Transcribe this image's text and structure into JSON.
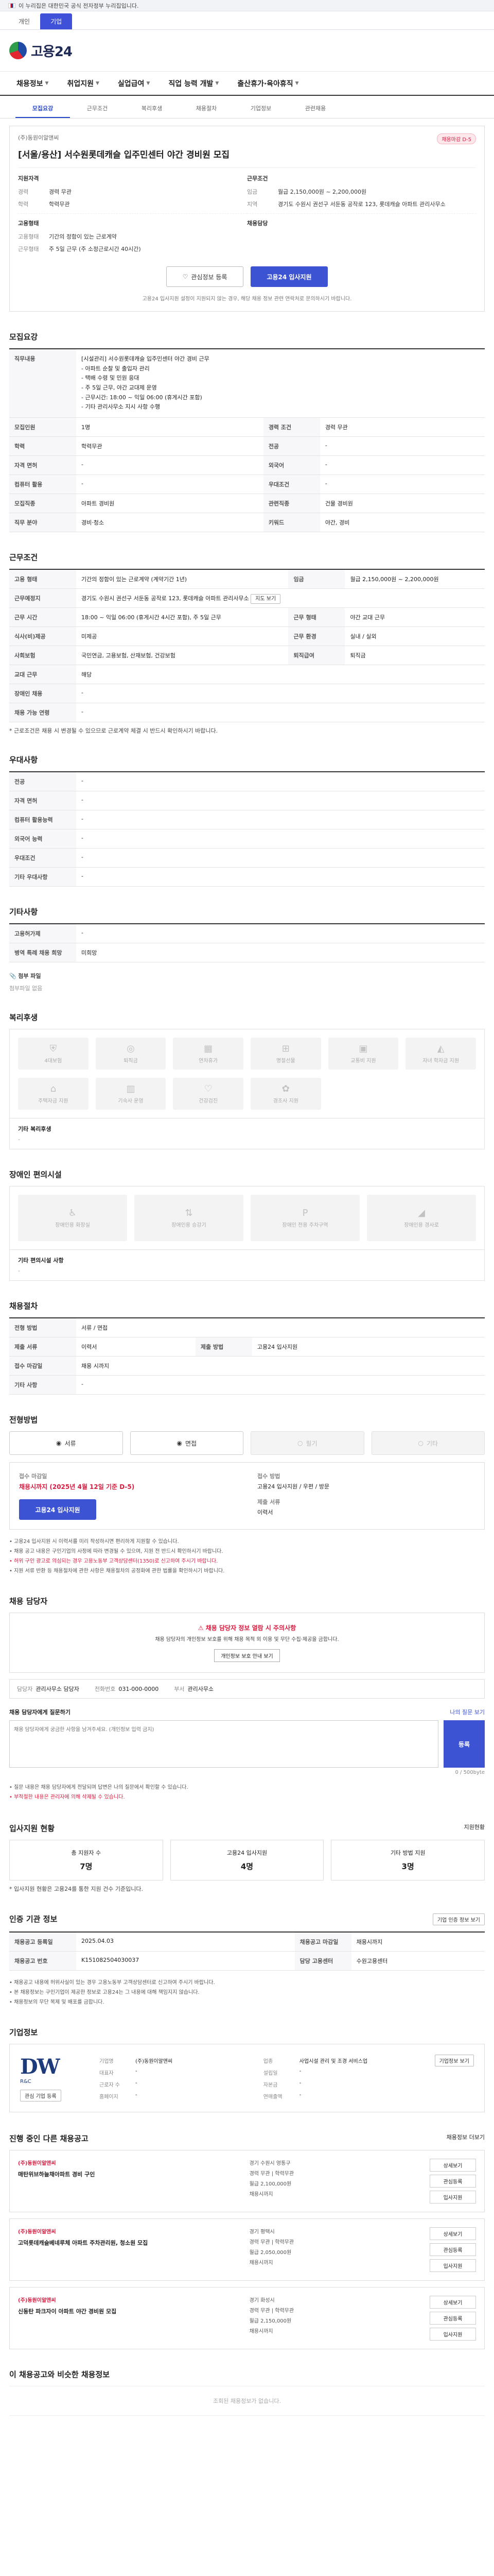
{
  "gov_banner": "이 누리집은 대한민국 공식 전자정부 누리집입니다.",
  "site_tabs": [
    "개인",
    "기업"
  ],
  "logo": "고용24",
  "gnb": [
    "채용정보",
    "취업지원",
    "실업급여",
    "직업 능력 개발",
    "출산휴가·육아휴직"
  ],
  "detail_tabs": [
    "모집요강",
    "근무조건",
    "복리후생",
    "채용절차",
    "기업정보",
    "관련채용"
  ],
  "summary": {
    "company": "(주)동원이알앤씨",
    "badge": "채용마감 D-5",
    "title": "[서울/용산] 서수원롯데캐슬 입주민센터 야간 경비원 모집",
    "left_head": "지원자격",
    "left": [
      {
        "k": "경력",
        "v": "경력 무관"
      },
      {
        "k": "학력",
        "v": "학력무관"
      }
    ],
    "right_head": "근무조건",
    "right": [
      {
        "k": "임금",
        "v": "월급 2,150,000원 ~ 2,200,000원"
      },
      {
        "k": "지역",
        "v": "경기도 수원시 권선구 서둔동 공작로 123, 롯데캐슬 아파트 관리사무소"
      }
    ],
    "left2_head": "고용형태",
    "left2": [
      {
        "k": "고용형태",
        "v": "기간의 정함이 있는 근로계약"
      },
      {
        "k": "근무형태",
        "v": "주 5일 근무 (주 소정근로시간 40시간)"
      }
    ],
    "right2_head": "채용담당",
    "right2": [
      {
        "k": "",
        "v": ""
      }
    ],
    "btn_scrap": "관심정보 등록",
    "btn_apply": "고용24 입사지원",
    "note": "고용24 입사지원 설정이 지원되지 않는 경우, 해당 채용 정보 관련 연락처로 문의하시기 바랍니다."
  },
  "recruit": {
    "title": "모집요강",
    "rows": [
      {
        "k": "직무내용",
        "v": "[시설관리] 서수원롯데캐슬 입주민센터 야간 경비 근무\n- 아파트 순찰 및 출입자 관리\n- 택배 수령 및 민원 응대\n- 주 5일 근무, 야간 교대제 운영\n- 근무시간: 18:00 ~ 익일 06:00 (휴게시간 포함)\n- 기타 관리사무소 지시 사항 수행"
      },
      {
        "k": "모집인원",
        "v": "1명",
        "k2": "경력 조건",
        "v2": "경력 무관"
      },
      {
        "k": "학력",
        "v": "학력무관",
        "k2": "전공",
        "v2": "-"
      },
      {
        "k": "자격 면허",
        "v": "-",
        "k2": "외국어",
        "v2": "-"
      },
      {
        "k": "컴퓨터 활용",
        "v": "-",
        "k2": "우대조건",
        "v2": "-"
      },
      {
        "k": "모집직종",
        "v": "아파트 경비원",
        "k2": "관련직종",
        "v2": "건물 경비원"
      },
      {
        "k": "직무 분야",
        "v": "경비·청소",
        "k2": "키워드",
        "v2": "야간, 경비"
      }
    ]
  },
  "conditions": {
    "title": "근무조건",
    "rows": [
      {
        "k": "고용 형태",
        "v": "기간의 정함이 있는 근로계약 (계약기간 1년)",
        "k2": "임금",
        "v2": "월급 2,150,000원 ~ 2,200,000원"
      },
      {
        "k": "근무예정지",
        "v": "경기도 수원시 권선구 서둔동 공작로 123, 롯데캐슬 아파트 관리사무소",
        "k2": "",
        "v2": ""
      },
      {
        "k": "근무 시간",
        "v": "18:00 ~ 익일 06:00 (휴게시간 4시간 포함), 주 5일 근무",
        "k2": "근무 형태",
        "v2": "야간 교대 근무"
      },
      {
        "k": "식사(비)제공",
        "v": "미제공",
        "k2": "근무 환경",
        "v2": "실내 / 실외"
      },
      {
        "k": "사회보험",
        "v": "국민연금, 고용보험, 산재보험, 건강보험",
        "k2": "퇴직급여",
        "v2": "퇴직금"
      },
      {
        "k": "교대 근무",
        "v": "해당",
        "k2": "",
        "v2": ""
      },
      {
        "k": "장애인 채용",
        "v": "-",
        "k2": "",
        "v2": ""
      },
      {
        "k": "채용 가능 연령",
        "v": "-",
        "k2": "",
        "v2": ""
      }
    ],
    "map_btn": "지도 보기",
    "note": "* 근로조건은 채용 시 변경될 수 있으므로 근로계약 체결 시 반드시 확인하시기 바랍니다."
  },
  "prefs": {
    "title": "우대사항",
    "rows": [
      {
        "k": "전공",
        "v": "-"
      },
      {
        "k": "자격 면허",
        "v": "-"
      },
      {
        "k": "컴퓨터 활용능력",
        "v": "-"
      },
      {
        "k": "외국어 능력",
        "v": "-"
      },
      {
        "k": "우대조건",
        "v": "-"
      },
      {
        "k": "기타 우대사항",
        "v": "-"
      }
    ]
  },
  "etc": {
    "title": "기타사항",
    "rows": [
      {
        "k": "고용허가제",
        "v": "-"
      },
      {
        "k": "병역 특례 채용 희망",
        "v": "미희망"
      }
    ],
    "attach_label": "첨부 파일",
    "attach_value": "첨부파일 없음"
  },
  "welfare": {
    "title": "복리후생",
    "items": [
      "4대보험",
      "퇴직금",
      "연차휴가",
      "명절선물",
      "교통비 지원",
      "자녀 학자금 지원",
      "주택자금 지원",
      "기숙사 운영",
      "건강검진",
      "경조사 지원",
      "",
      ""
    ],
    "etc_label": "기타 복리후생",
    "etc_value": "-"
  },
  "disability": {
    "title": "장애인 편의시설",
    "items": [
      "장애인용 화장실",
      "장애인용 승강기",
      "장애인 전용 주차구역",
      "장애인용 경사로"
    ],
    "etc_label": "기타 편의시설 사항",
    "etc_value": "-"
  },
  "process": {
    "title": "채용절차",
    "rows": [
      {
        "k": "전형 방법",
        "v": "서류 / 면접"
      },
      {
        "k": "제출 서류",
        "v": "이력서",
        "k2": "제출 방법",
        "v2": "고용24 입사지원"
      },
      {
        "k": "접수 마감일",
        "v": "채용 시까지",
        "k2": "",
        "v2": ""
      },
      {
        "k": "기타 사항",
        "v": "-",
        "k2": "",
        "v2": ""
      }
    ]
  },
  "apply_method": {
    "title": "전형방법",
    "methods": [
      "서류",
      "면접",
      "필기",
      "기타"
    ],
    "k1": "접수 마감일",
    "v1": "채용시까지 (2025년 4월 12일 기준 D-5)",
    "k2": "접수 방법",
    "v2": "고용24 입사지원 / 우편 / 방문",
    "k3": "제출 서류",
    "v3": "이력서",
    "btn": "고용24 입사지원",
    "notes": [
      "고용24 입사지원 시 이력서를 미리 작성하시면 편리하게 지원할 수 있습니다.",
      "채용 공고 내용은 구인기업의 사정에 따라 변경될 수 있으며, 지원 전 반드시 확인하시기 바랍니다.",
      "허위 구인 광고로 의심되는 경우 고용노동부 고객상담센터(1350)로 신고하여 주시기 바랍니다.",
      "지원 서류 반환 등 채용절차에 관한 사항은 채용절차의 공정화에 관한 법률을 확인하시기 바랍니다."
    ]
  },
  "contact": {
    "title": "채용 담당자",
    "notice_title": "채용 담당자 정보 열람 시 주의사항",
    "notice_text": "채용 담당자의 개인정보 보호를 위해 채용 목적 외 이용 및 무단 수집·제공을 금합니다.",
    "notice_btn": "개인정보 보호 안내 보기",
    "name_k": "담당자",
    "name_v": "관리사무소 담당자",
    "tel_k": "전화번호",
    "tel_v": "031-000-0000",
    "dept_k": "부서",
    "dept_v": "관리사무소",
    "inquiry_title": "채용 담당자에게 질문하기",
    "inquiry_link": "나의 질문 보기",
    "inquiry_placeholder": "채용 담당자에게 궁금한 사항을 남겨주세요. (개인정보 입력 금지)",
    "inquiry_count": "0 / 500byte",
    "inquiry_btn": "등록",
    "inquiry_notes": [
      "질문 내용은 채용 담당자에게 전달되며 답변은 나의 질문에서 확인할 수 있습니다.",
      "부적절한 내용은 관리자에 의해 삭제될 수 있습니다."
    ]
  },
  "applicants": {
    "title": "입사지원 현황",
    "more": "지원현황",
    "cards": [
      {
        "k": "총 지원자 수",
        "v": "7명"
      },
      {
        "k": "고용24 입사지원",
        "v": "4명"
      },
      {
        "k": "기타 방법 지원",
        "v": "3명"
      }
    ],
    "note": "* 입사지원 현황은 고용24를 통한 지원 건수 기준입니다."
  },
  "info": {
    "title": "인증 기관 정보",
    "btn": "기업 인증 정보 보기",
    "rows": [
      {
        "k": "채용공고 등록일",
        "v": "2025.04.03",
        "k2": "채용공고 마감일",
        "v2": "채용시까지"
      },
      {
        "k": "채용공고 번호",
        "v": "K151082504030037",
        "k2": "담당 고용센터",
        "v2": "수원고용센터"
      }
    ],
    "notes": [
      "채용공고 내용에 허위사실이 있는 경우 고용노동부 고객상담센터로 신고하여 주시기 바랍니다.",
      "본 채용정보는 구인기업이 제공한 정보로 고용24는 그 내용에 대해 책임지지 않습니다.",
      "채용정보의 무단 복제 및 배포를 금합니다."
    ]
  },
  "company": {
    "title": "기업정보",
    "logo_main": "DW",
    "logo_sub": "R&C",
    "scrap_btn": "관심 기업 등록",
    "detail_btn": "기업정보 보기",
    "rows": [
      {
        "k": "기업명",
        "v": "(주)동원이알앤씨"
      },
      {
        "k": "업종",
        "v": "사업시설 관리 및 조경 서비스업"
      },
      {
        "k": "대표자",
        "v": "-"
      },
      {
        "k": "설립일",
        "v": "-"
      },
      {
        "k": "근로자 수",
        "v": "-"
      },
      {
        "k": "자본금",
        "v": "-"
      },
      {
        "k": "홈페이지",
        "v": "-"
      },
      {
        "k": "연매출액",
        "v": "-"
      }
    ]
  },
  "related": {
    "title": "진행 중인 다른 채용공고",
    "more": "채용정보 더보기",
    "items": [
      {
        "co": "(주)동원이알앤씨",
        "t": "매탄위브하늘채아파트 경비 구인",
        "a": "경기 수원시 영통구",
        "b": "경력 무관 | 학력무관",
        "c": "월급 2,100,000원",
        "d": "채용시까지"
      },
      {
        "co": "(주)동원이알앤씨",
        "t": "고덕롯데캐슬베네루체 아파트 주차관리원, 청소원 모집",
        "a": "경기 평택시",
        "b": "경력 무관 | 학력무관",
        "c": "월급 2,050,000원",
        "d": "채용시까지"
      },
      {
        "co": "(주)동원이알앤씨",
        "t": "신동탄 파크자이 아파트 야간 경비원 모집",
        "a": "경기 화성시",
        "b": "경력 무관 | 학력무관",
        "c": "월급 2,150,000원",
        "d": "채용시까지"
      }
    ],
    "btn_view": "상세보기",
    "btn_scrap": "관심등록",
    "btn_apply": "입사지원"
  },
  "similar": {
    "title": "이 채용공고와 비슷한 채용정보",
    "empty": "조회된 채용정보가 없습니다."
  },
  "top": "TOP"
}
